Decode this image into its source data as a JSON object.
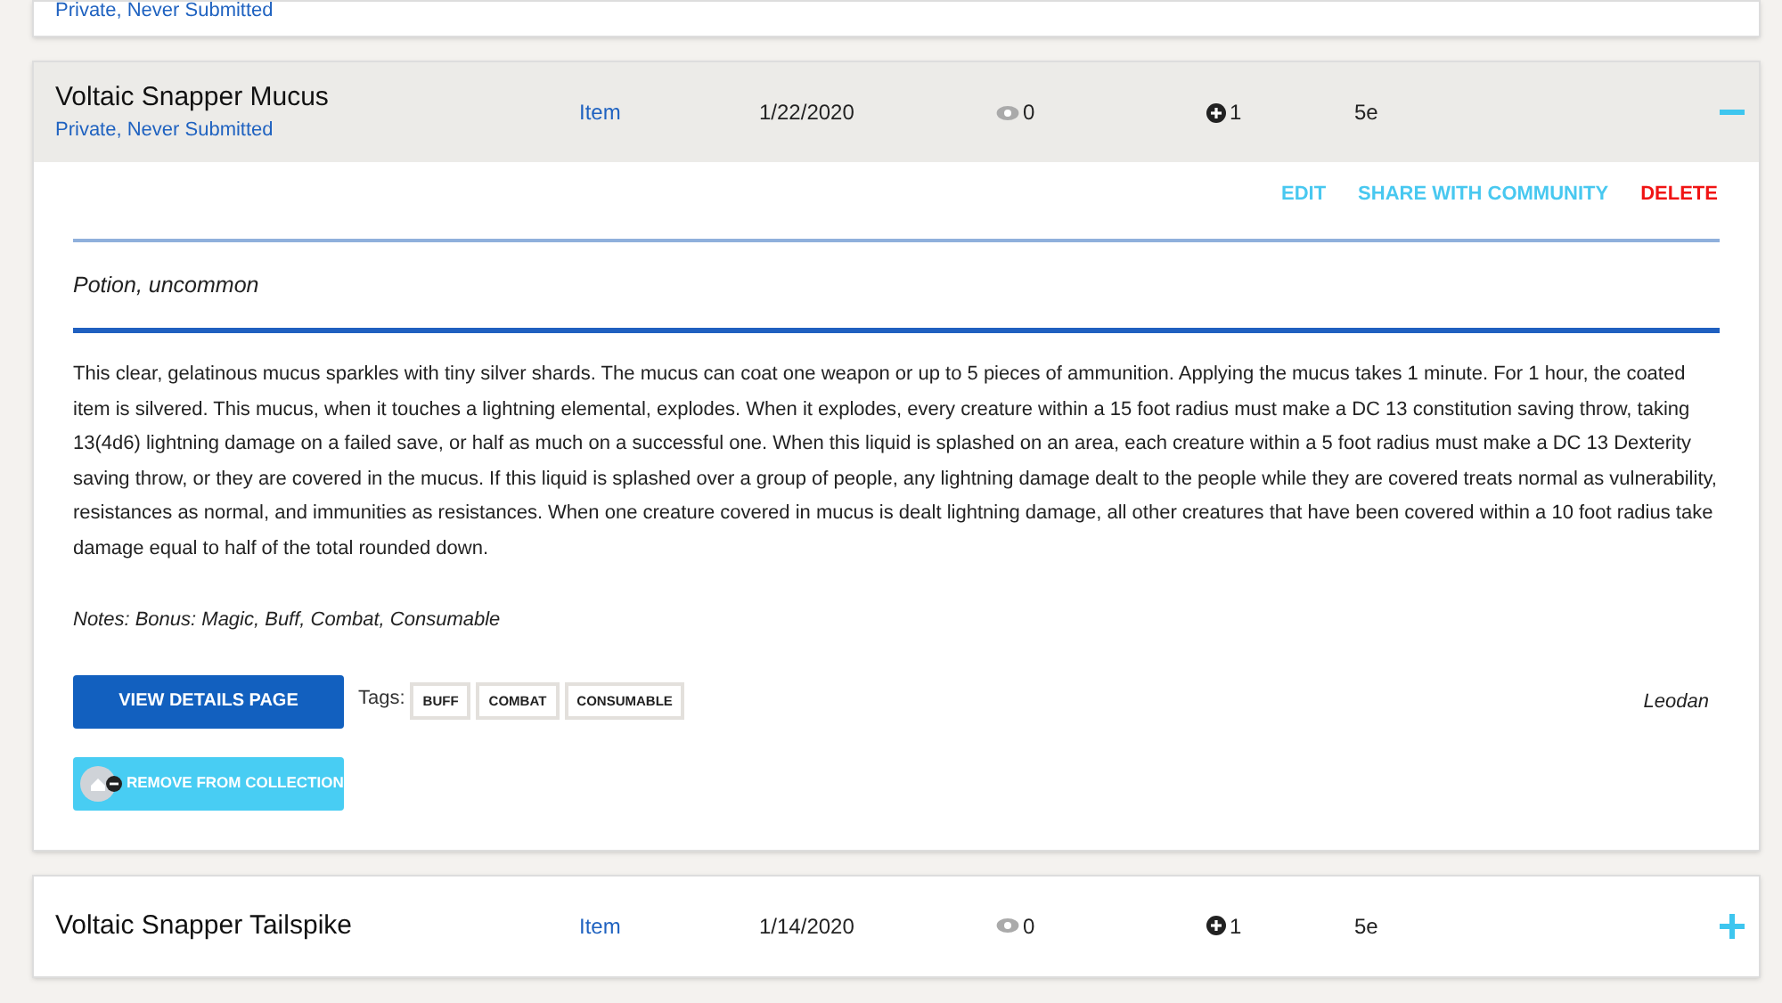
{
  "entries": [
    {
      "subtitle": "Private, Never Submitted"
    },
    {
      "title": "Voltaic Snapper Mucus",
      "subtitle": "Private, Never Submitted",
      "type": "Item",
      "date": "1/22/2020",
      "views": "0",
      "count": "1",
      "edition": "5e",
      "expanded": true,
      "details": {
        "actions": [
          {
            "label": "EDIT",
            "kind": "normal"
          },
          {
            "label": "SHARE WITH COMMUNITY",
            "kind": "normal"
          },
          {
            "label": "DELETE",
            "kind": "danger"
          }
        ],
        "category": "Potion, uncommon",
        "description": "This clear, gelatinous mucus sparkles with tiny silver shards. The mucus can coat one weapon or up to 5 pieces of ammunition. Applying the mucus takes 1 minute. For 1 hour, the coated item is silvered. This mucus, when it touches a lightning elemental, explodes. When it explodes, every creature within a 15 foot radius must make a DC 13 constitution saving throw, taking 13(4d6) lightning damage on a failed save, or half as much on a successful one. When this liquid is splashed on an area, each creature within a 5 foot radius must make a DC 13 Dexterity saving throw, or they are covered in the mucus. If this liquid is splashed over a group of people, any lightning damage dealt to the people while they are covered treats normal as vulnerability, resistances as normal, and immunities as resistances. When one creature covered in mucus is dealt lightning damage, all other creatures that have been covered within a 10 foot radius take damage equal to half of the total rounded down.",
        "notes": "Notes: Bonus: Magic, Buff, Combat, Consumable",
        "details_button": "VIEW DETAILS PAGE",
        "tags_label": "Tags:",
        "tags": [
          "BUFF",
          "COMBAT",
          "CONSUMABLE"
        ],
        "author": "Leodan",
        "collection_button": "REMOVE FROM COLLECTION"
      }
    },
    {
      "title": "Voltaic Snapper Tailspike",
      "type": "Item",
      "date": "1/14/2020",
      "views": "0",
      "count": "1",
      "edition": "5e",
      "expanded": false
    }
  ]
}
